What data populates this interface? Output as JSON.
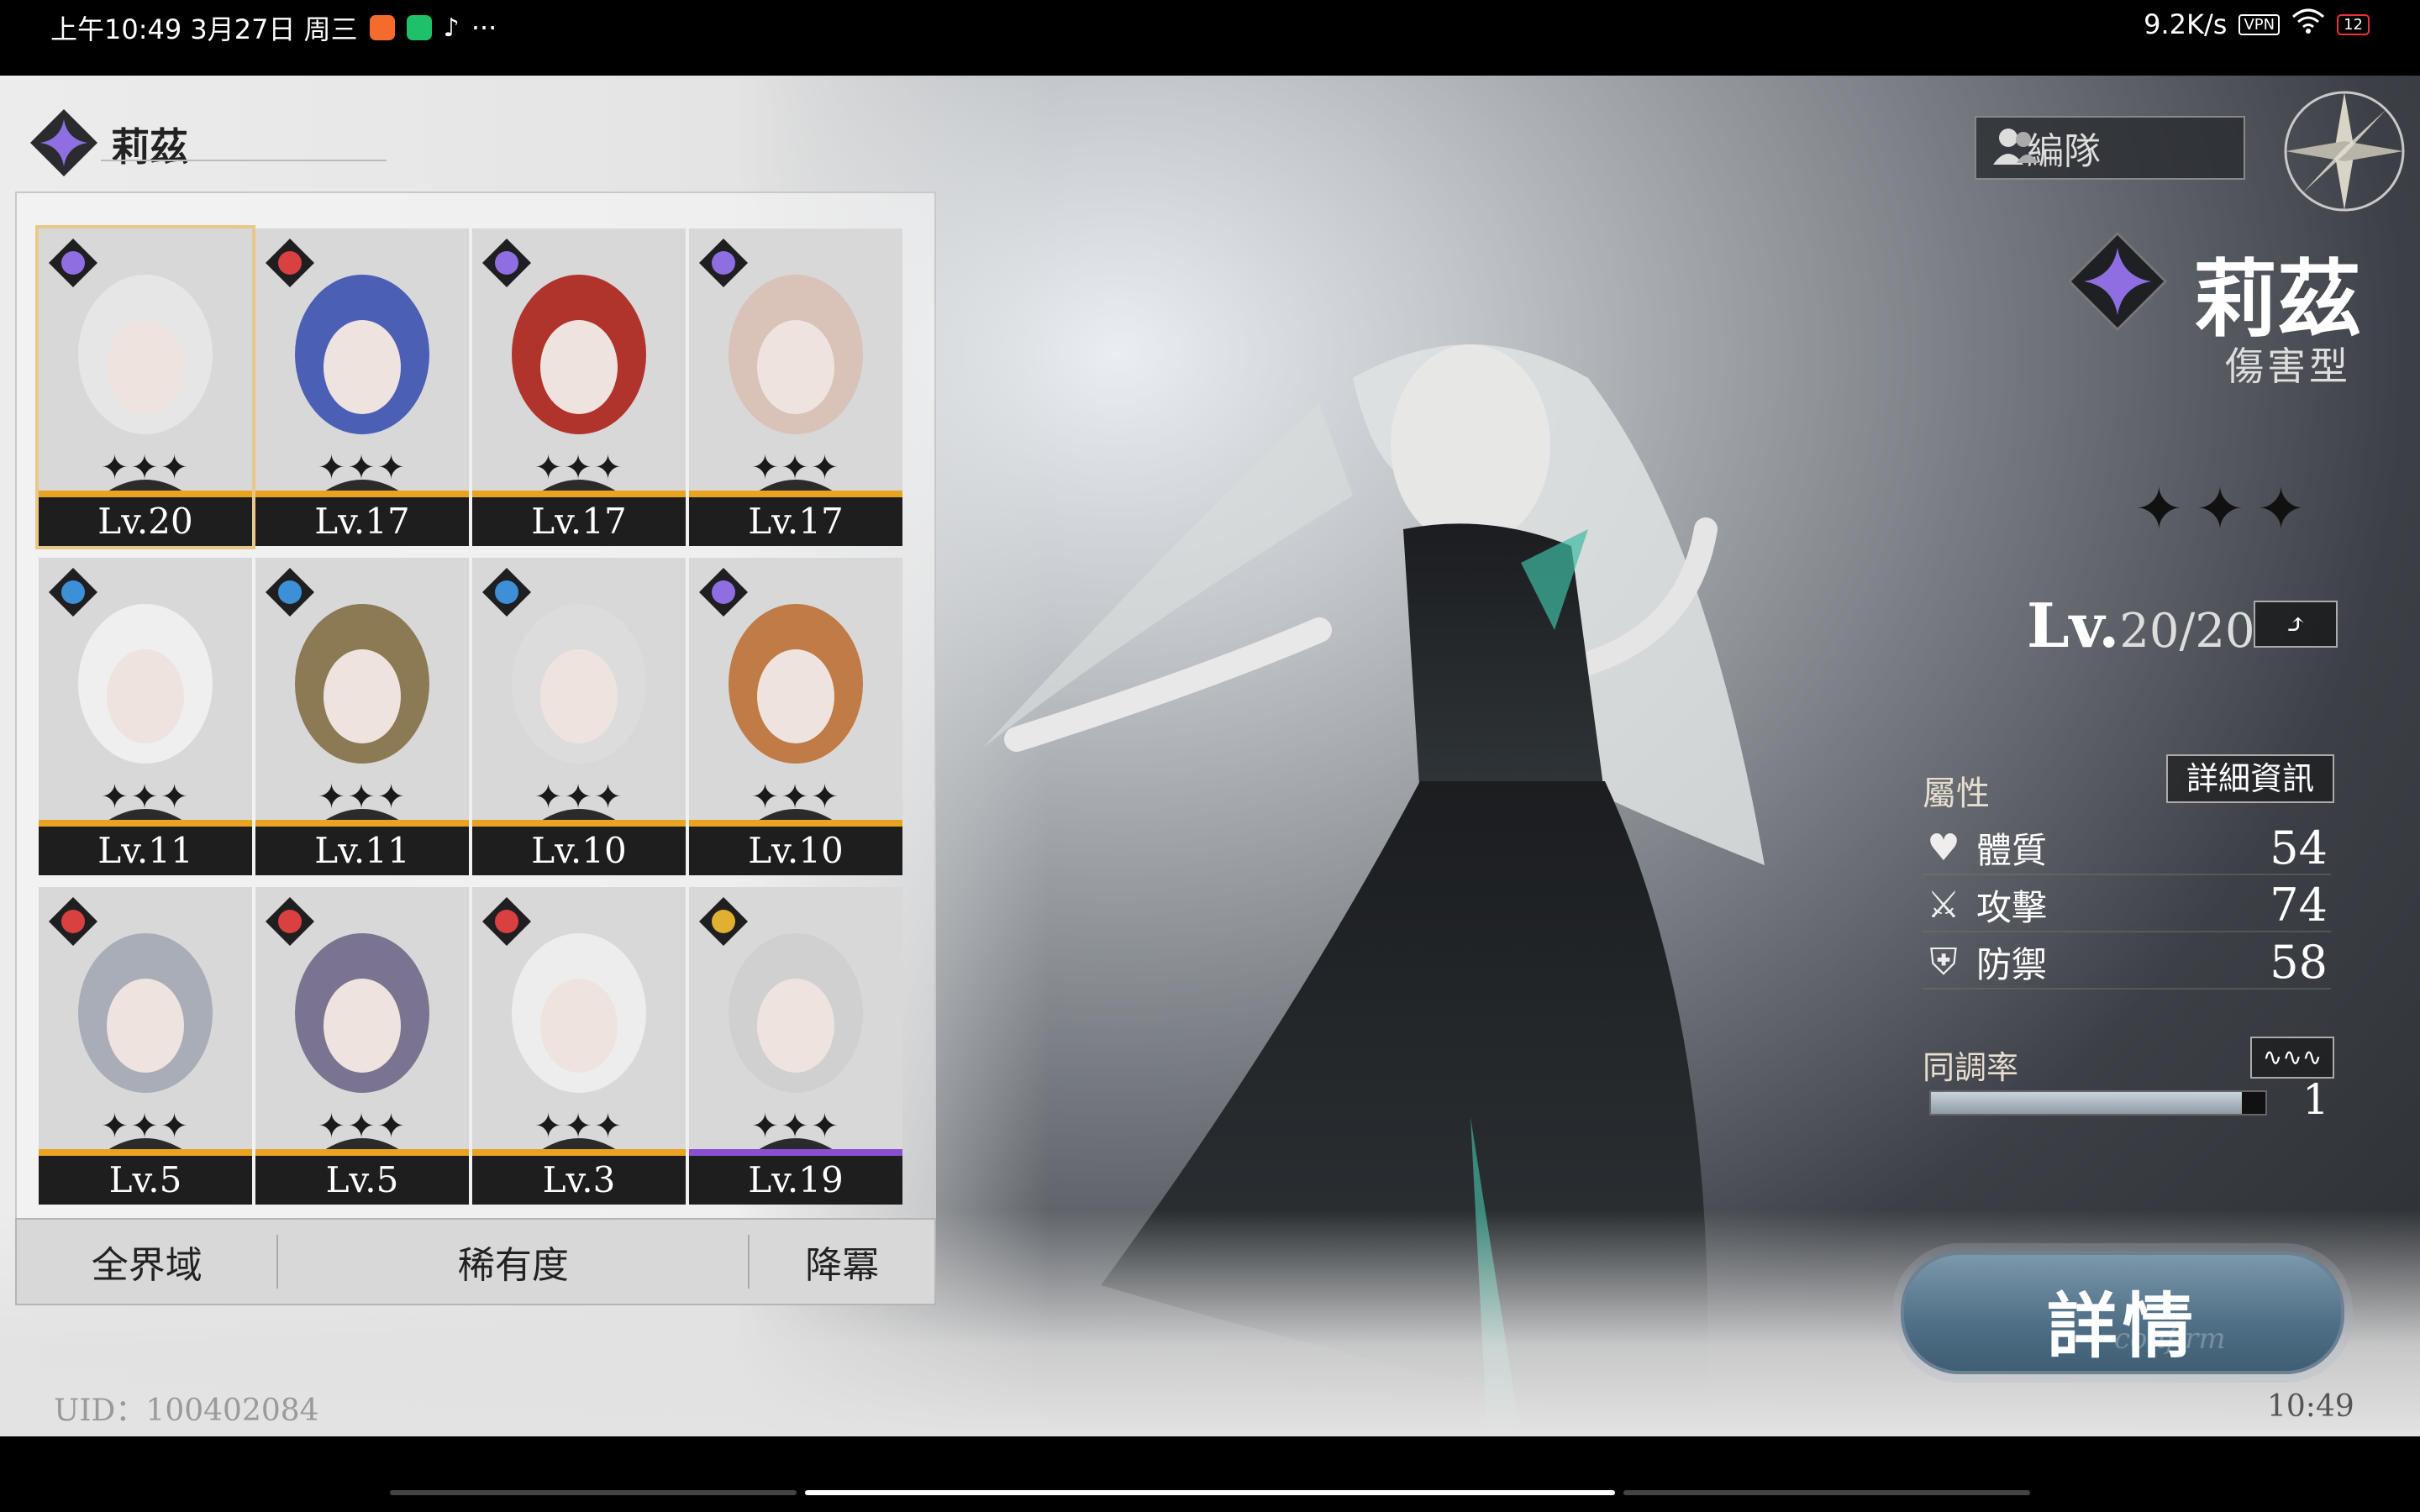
{
  "status_bar": {
    "time_date": "上午10:49 3月27日 周三",
    "more": "···",
    "net_speed": "9.2K/s",
    "vpn": "VPN",
    "battery": "12"
  },
  "character_list": {
    "header_name": "莉茲",
    "cards": [
      {
        "level": "Lv.20",
        "selected": true,
        "bar": "gold"
      },
      {
        "level": "Lv.17",
        "selected": false,
        "bar": "gold"
      },
      {
        "level": "Lv.17",
        "selected": false,
        "bar": "gold"
      },
      {
        "level": "Lv.17",
        "selected": false,
        "bar": "gold"
      },
      {
        "level": "Lv.11",
        "selected": false,
        "bar": "gold"
      },
      {
        "level": "Lv.11",
        "selected": false,
        "bar": "gold"
      },
      {
        "level": "Lv.10",
        "selected": false,
        "bar": "gold"
      },
      {
        "level": "Lv.10",
        "selected": false,
        "bar": "gold"
      },
      {
        "level": "Lv.5",
        "selected": false,
        "bar": "gold"
      },
      {
        "level": "Lv.5",
        "selected": false,
        "bar": "gold"
      },
      {
        "level": "Lv.3",
        "selected": false,
        "bar": "gold"
      },
      {
        "level": "Lv.19",
        "selected": false,
        "bar": "purple"
      }
    ]
  },
  "filters": {
    "domain": "全界域",
    "rarity": "稀有度",
    "sort": "降冪"
  },
  "footer": {
    "uid": "UID：100402084",
    "clock": "10:49"
  },
  "detail": {
    "team_button": "編隊",
    "name": "莉茲",
    "type": "傷害型",
    "level_prefix": "Lv.",
    "level_value": "20/20",
    "attributes_title": "屬性",
    "detail_info_button": "詳細資訊",
    "attributes": [
      {
        "name": "體質",
        "value": "54",
        "icon": "heart-icon"
      },
      {
        "name": "攻擊",
        "value": "74",
        "icon": "sword-icon"
      },
      {
        "name": "防禦",
        "value": "58",
        "icon": "shield-icon"
      }
    ],
    "sync_title": "同調率",
    "sync_value": "1",
    "sync_progress": 0.93,
    "details_button": "詳情",
    "details_sub": "confirm"
  },
  "colors": {
    "gold_bar": "#e8a321",
    "purple_bar": "#8a4fd1",
    "selection_outline": "#e8c88a",
    "emblem_purple": "#8e6ee0"
  }
}
